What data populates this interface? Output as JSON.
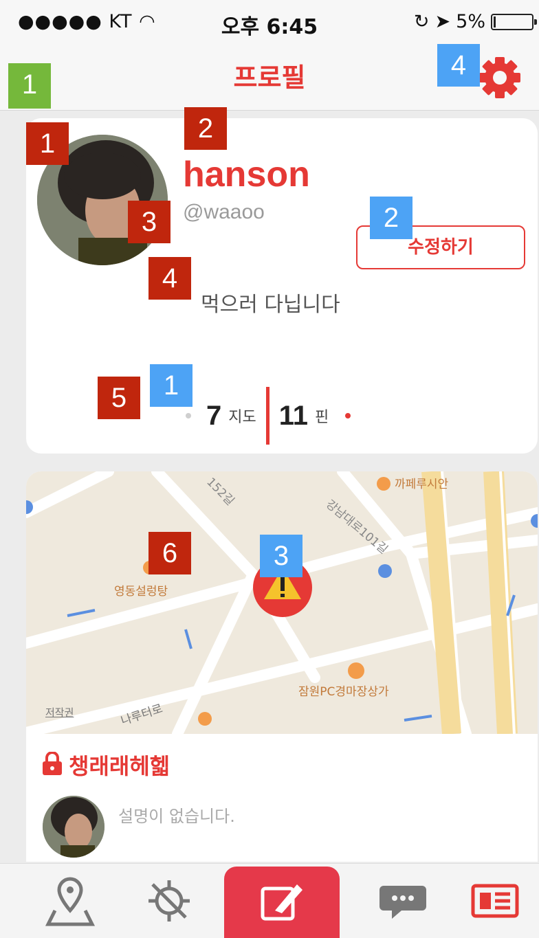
{
  "status_bar": {
    "carrier": "●●●●● KT",
    "time": "오후 6:45",
    "battery": "5%"
  },
  "header": {
    "title": "프로필"
  },
  "profile": {
    "name": "hanson",
    "handle": "@waaoo",
    "edit_label": "수정하기",
    "bio": "먹으러 다닙니다",
    "maps_count": "7",
    "maps_label": "지도",
    "pins_count": "11",
    "pins_label": "핀"
  },
  "map_card": {
    "labels": {
      "cafe": "까페루시안",
      "road1": "강남대로101길",
      "road2": "152길",
      "restaurant": "영동설렁탕",
      "pc": "잠원PC경마장상가",
      "road3": "나루터로",
      "credit": "저작권"
    },
    "title": "챙래래헤헯",
    "description": "설명이 없습니다."
  },
  "annotations": {
    "red": [
      "1",
      "2",
      "3",
      "4",
      "5",
      "6"
    ],
    "blue": [
      "1",
      "2",
      "3",
      "4"
    ],
    "green": [
      "1"
    ]
  },
  "colors": {
    "accent": "#e53935",
    "badge_red": "#c0260d",
    "badge_blue": "#4da3f5",
    "badge_green": "#75b83b"
  },
  "tabbar": {
    "icons": [
      "map-pin-icon",
      "compass-icon",
      "write-icon",
      "chat-icon",
      "profile-card-icon"
    ]
  }
}
